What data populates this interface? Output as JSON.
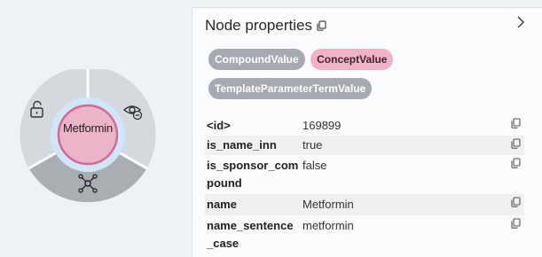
{
  "node_menu": {
    "node_label": "Metformin",
    "icons": [
      "unlock-icon",
      "hide-eye-icon",
      "expand-network-icon"
    ]
  },
  "panel": {
    "title": "Node properties",
    "labels": [
      {
        "text": "CompoundValue",
        "style": "gray"
      },
      {
        "text": "ConceptValue",
        "style": "pink"
      },
      {
        "text": "TemplateParameterTermValue",
        "style": "gray"
      }
    ],
    "properties": [
      {
        "key": "<id>",
        "value": "169899"
      },
      {
        "key": "is_name_inn",
        "value": "true"
      },
      {
        "key": "is_sponsor_com\npound",
        "value": "false"
      },
      {
        "key": "name",
        "value": "Metformin"
      },
      {
        "key": "name_sentence\n_case",
        "value": "metformin"
      }
    ]
  },
  "colors": {
    "node_fill": "#ebb4c8",
    "node_border": "#d46a93",
    "node_halo": "#cfe6f8",
    "chip_gray": "#a5aab0",
    "chip_pink": "#f1b2c9"
  }
}
